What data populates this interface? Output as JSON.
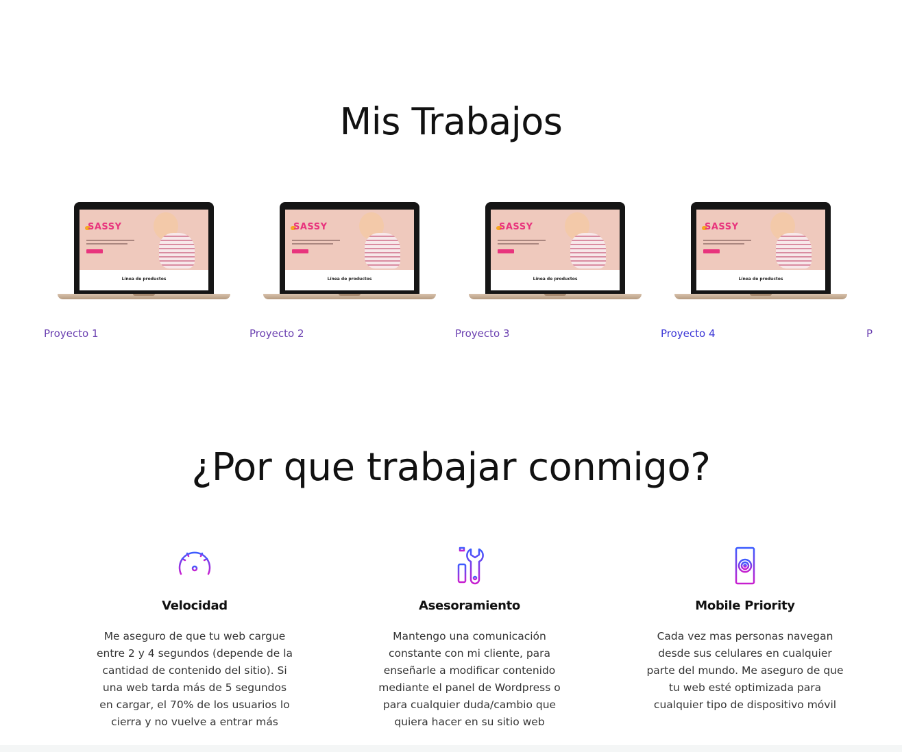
{
  "works": {
    "title": "Mis Trabajos",
    "projects": [
      {
        "label": "Proyecto 1",
        "color": "#6a3fb0"
      },
      {
        "label": "Proyecto 2",
        "color": "#6a3fb0"
      },
      {
        "label": "Proyecto 3",
        "color": "#6a3fb0"
      },
      {
        "label": "Proyecto 4",
        "color": "#3b36d6"
      },
      {
        "label": "P",
        "color": "#6a3fb0"
      }
    ],
    "mockup": {
      "brand": "SASSY",
      "products_label": "Línea de productos"
    }
  },
  "why": {
    "title": "¿Por que trabajar conmigo?",
    "features": [
      {
        "icon": "speedometer-icon",
        "title": "Velocidad",
        "text": "Me aseguro de que tu web cargue entre 2 y 4 segundos (depende de la cantidad de contenido del sitio). Si una web tarda más de 5 segundos en cargar, el 70% de los usuarios lo cierra y no vuelve a entrar más"
      },
      {
        "icon": "tools-icon",
        "title": "Asesoramiento",
        "text": "Mantengo una comunicación constante con mi cliente, para enseñarle a modificar contenido mediante el panel de Wordpress o para cualquier duda/cambio que quiera hacer en su sitio web"
      },
      {
        "icon": "mobile-icon",
        "title": "Mobile Priority",
        "text": "Cada vez mas personas navegan desde sus celulares en cualquier parte del mundo. Me aseguro de que tu web esté optimizada para cualquier tipo de dispositivo móvil"
      }
    ]
  },
  "colors": {
    "icon_gradient_start": "#3b5bff",
    "icon_gradient_end": "#c81ecf",
    "project_link": "#6a3fb0",
    "project_link_active": "#3b36d6"
  }
}
